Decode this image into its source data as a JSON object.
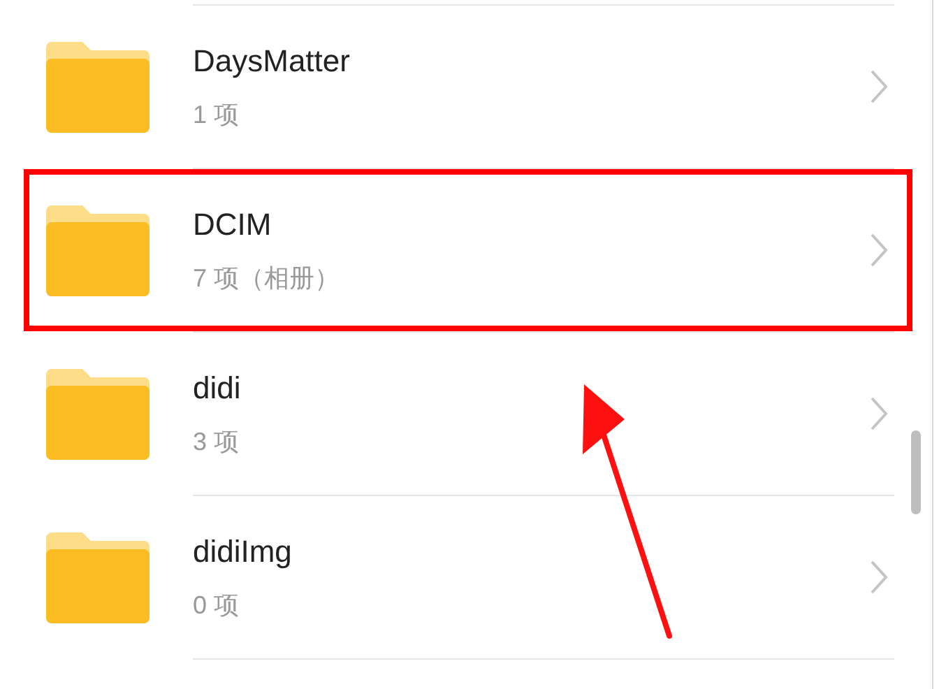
{
  "folders": [
    {
      "name": "DaysMatter",
      "details": "1 项",
      "highlighted": false
    },
    {
      "name": "DCIM",
      "details": "7 项（相册）",
      "highlighted": true
    },
    {
      "name": "didi",
      "details": "3 项",
      "highlighted": false
    },
    {
      "name": "didiImg",
      "details": "0 项",
      "highlighted": false
    }
  ]
}
